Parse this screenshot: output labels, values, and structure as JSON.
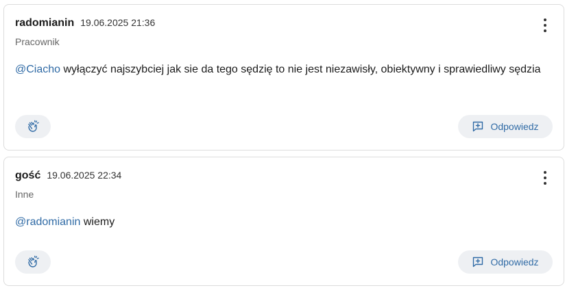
{
  "comments": [
    {
      "author": "radomianin",
      "date": "19.06.2025 21:36",
      "role": "Pracownik",
      "mention": "@Ciacho",
      "text": " wyłączyć najszybciej jak sie da tego sędzię to nie jest niezawisły, obiektywny i sprawiedliwy sędzia",
      "reply_label": "Odpowiedz"
    },
    {
      "author": "gość",
      "date": "19.06.2025 22:34",
      "role": "Inne",
      "mention": "@radomianin",
      "text": " wiemy",
      "reply_label": "Odpowiedz"
    }
  ],
  "icons": {
    "menu": "vertical-dots-icon",
    "react": "clapping-hands-icon",
    "reply": "reply-plus-icon"
  },
  "colors": {
    "mention": "#2f6aa5",
    "button_bg": "#eef0f3",
    "border": "#dcdcdc"
  }
}
